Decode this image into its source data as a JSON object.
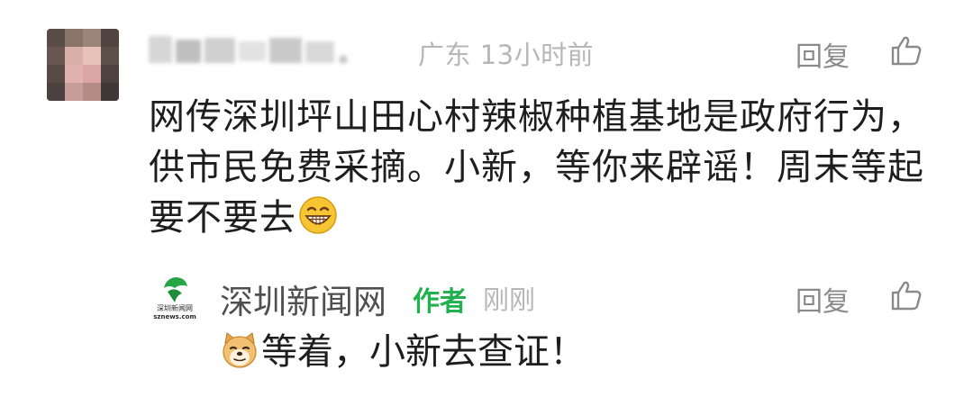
{
  "comment": {
    "location": "广东",
    "time": "13小时前",
    "reply_label": "回复",
    "text": "网传深圳坪山田心村辣椒种植基地是政府行为，供市民免费采摘。小新，等你来辟谣！周末等起要不要去",
    "emoji": "grinning-face"
  },
  "reply": {
    "author": "深圳新闻网",
    "badge": "作者",
    "time": "刚刚",
    "reply_label": "回复",
    "text": "等着，小新去查证！",
    "emoji": "doge-face",
    "logo_text": "深圳新闻网",
    "logo_subtext": "sznews.com"
  },
  "colors": {
    "author_badge": "#21b24f",
    "meta_text": "#b7b7b7",
    "body_text": "#1e1e1e"
  }
}
